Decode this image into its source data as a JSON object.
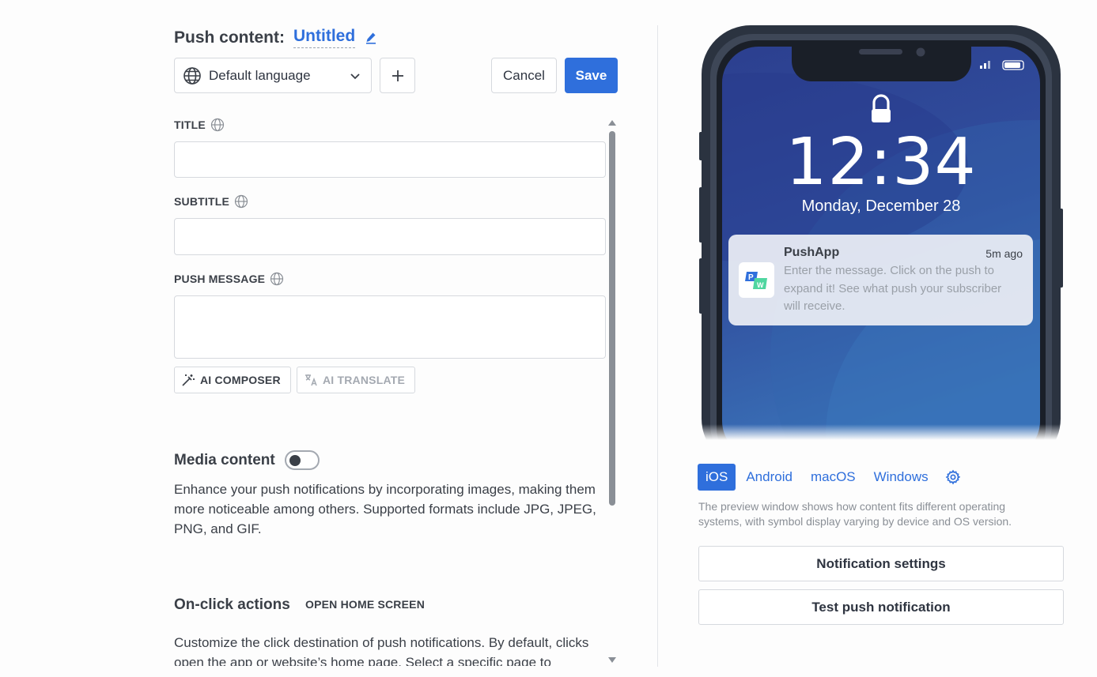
{
  "header": {
    "label": "Push content:",
    "document_name": "Untitled",
    "edit_icon": "pen-icon"
  },
  "toolbar": {
    "language_select": "Default language",
    "language_icon": "globe-icon",
    "add_icon": "plus-icon",
    "cancel_label": "Cancel",
    "save_label": "Save"
  },
  "form": {
    "title_label": "TITLE",
    "title_value": "",
    "subtitle_label": "SUBTITLE",
    "subtitle_value": "",
    "message_label": "PUSH MESSAGE",
    "message_value": "",
    "ai_composer_label": "AI COMPOSER",
    "ai_translate_label": "AI TRANSLATE"
  },
  "media": {
    "title": "Media content",
    "enabled": false,
    "description": "Enhance your push notifications by incorporating images, making them more noticeable among others. Supported formats include JPG, JPEG, PNG, and GIF."
  },
  "onclick": {
    "title": "On-click actions",
    "action": "OPEN HOME SCREEN",
    "description": "Customize the click destination of push notifications. By default, clicks open the app or website’s home page. Select a specific page to"
  },
  "preview": {
    "time": "12:34",
    "date": "Monday, December 28",
    "notification": {
      "app_name": "PushApp",
      "age": "5m ago",
      "message": "Enter the message. Click on the push to expand it! See what push your subscriber will receive."
    },
    "os_tabs": [
      "iOS",
      "Android",
      "macOS",
      "Windows"
    ],
    "active_os": "iOS",
    "note": "The preview window shows how content fits different operating systems, with symbol display varying by device and OS version.",
    "notification_settings_label": "Notification settings",
    "test_push_label": "Test push notification"
  },
  "colors": {
    "accent": "#2f6fdc",
    "phone_bezel": "#2b3340",
    "lock_screen": "#2f4a9a"
  }
}
